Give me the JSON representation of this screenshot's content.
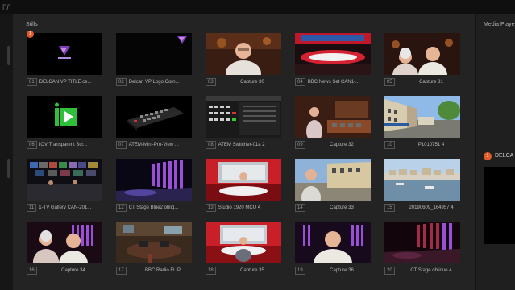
{
  "topbar": {
    "text": "ГЛ"
  },
  "stills": {
    "title": "Stills",
    "selected_badge": "1",
    "items": [
      {
        "num": "01",
        "label": "DELCAN  VP TITLE ce...",
        "centered": false
      },
      {
        "num": "02",
        "label": "Delcan VP Logo Corn...",
        "centered": false
      },
      {
        "num": "03",
        "label": "Capture 30",
        "centered": true
      },
      {
        "num": "04",
        "label": "BBC News Set CAN1-...",
        "centered": false
      },
      {
        "num": "05",
        "label": "Capture 31",
        "centered": true
      },
      {
        "num": "06",
        "label": "IOV Transparent Scr...",
        "centered": false
      },
      {
        "num": "07",
        "label": "ATEM-Mini-Pro-View ...",
        "centered": false
      },
      {
        "num": "08",
        "label": "ATEM Switcher-01a 2",
        "centered": false
      },
      {
        "num": "09",
        "label": "Capture 32",
        "centered": true
      },
      {
        "num": "10",
        "label": "P1010751 4",
        "centered": true
      },
      {
        "num": "11",
        "label": "1-TV Gallery CAN-201...",
        "centered": false
      },
      {
        "num": "12",
        "label": "CT Stage Blue2 obliq...",
        "centered": false
      },
      {
        "num": "13",
        "label": "Studio 1920 MCU 4",
        "centered": false
      },
      {
        "num": "14",
        "label": "Capture 33",
        "centered": true
      },
      {
        "num": "15",
        "label": "20190609_164957 4",
        "centered": true
      },
      {
        "num": "16",
        "label": "Capture 34",
        "centered": true
      },
      {
        "num": "17",
        "label": "BBC Radio FLIP",
        "centered": true
      },
      {
        "num": "18",
        "label": "Capture 35",
        "centered": true
      },
      {
        "num": "19",
        "label": "Capture 36",
        "centered": true
      },
      {
        "num": "20",
        "label": "CT Stage oblique 4",
        "centered": true
      }
    ]
  },
  "media_player": {
    "title": "Media Playe",
    "badge": "1",
    "clip": "DELCA"
  },
  "colors": {
    "badge": "#e05a2a",
    "background": "#1d1d1d",
    "panel": "#232323"
  }
}
